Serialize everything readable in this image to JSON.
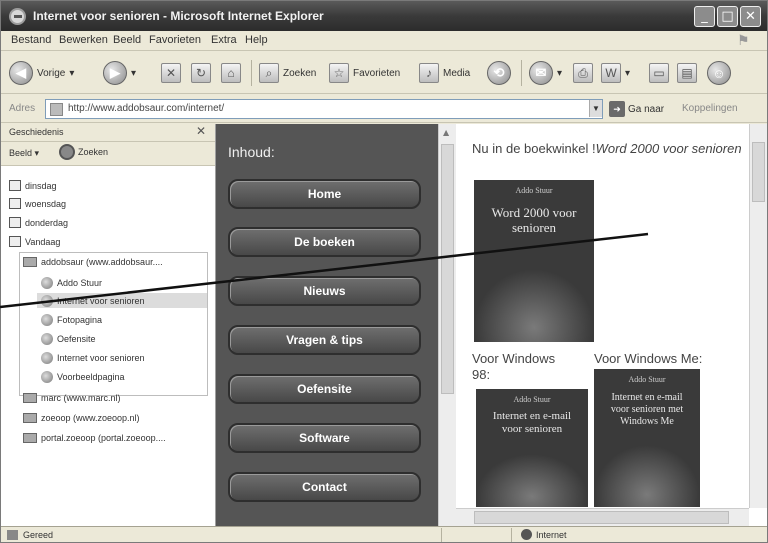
{
  "window": {
    "title": "Internet voor senioren - Microsoft Internet Explorer"
  },
  "menu": [
    "Bestand",
    "Bewerken",
    "Beeld",
    "Favorieten",
    "Extra",
    "Help"
  ],
  "toolbar": {
    "back": "Vorige",
    "search": "Zoeken",
    "favorites": "Favorieten",
    "media": "Media"
  },
  "address": {
    "label": "Adres",
    "url": "http://www.addobsaur.com/internet/",
    "go": "Ga naar",
    "links": "Koppelingen"
  },
  "sidebar": {
    "title": "Geschiedenis",
    "view": "Beeld",
    "search": "Zoeken",
    "items": [
      {
        "label": "dinsdag"
      },
      {
        "label": "woensdag"
      },
      {
        "label": "donderdag"
      },
      {
        "label": "Vandaag"
      },
      {
        "label": "addobsaur (www.addobsaur...."
      },
      {
        "label": "Addo Stuur"
      },
      {
        "label": "Internet voor senioren"
      },
      {
        "label": "Fotopagina"
      },
      {
        "label": "Oefensite"
      },
      {
        "label": "Internet voor senioren"
      },
      {
        "label": "Voorbeeldpagina"
      },
      {
        "label": "marc (www.marc.nl)"
      },
      {
        "label": "zoeoop (www.zoeoop.nl)"
      },
      {
        "label": "portal.zoeoop (portal.zoeoop...."
      }
    ]
  },
  "content": {
    "heading": "Inhoud:",
    "nav": [
      "Home",
      "De boeken",
      "Nieuws",
      "Vragen & tips",
      "Oefensite",
      "Software",
      "Contact"
    ],
    "promo_prefix": "Nu in de boekwinkel !",
    "promo_title": "Word 2000 voor senioren",
    "book1": {
      "publisher": "Addo Stuur",
      "title": "Word 2000 voor senioren"
    },
    "book2": {
      "publisher": "Addo Stuur",
      "title": "Internet en e-mail voor senioren"
    },
    "book3": {
      "publisher": "Addo Stuur",
      "title": "Internet en e-mail voor senioren met Windows Me"
    },
    "label_win98_a": "Voor Windows",
    "label_win98_b": "98:",
    "label_me": "Voor Windows Me:"
  },
  "status": {
    "text": "Gereed",
    "zone": "Internet"
  }
}
